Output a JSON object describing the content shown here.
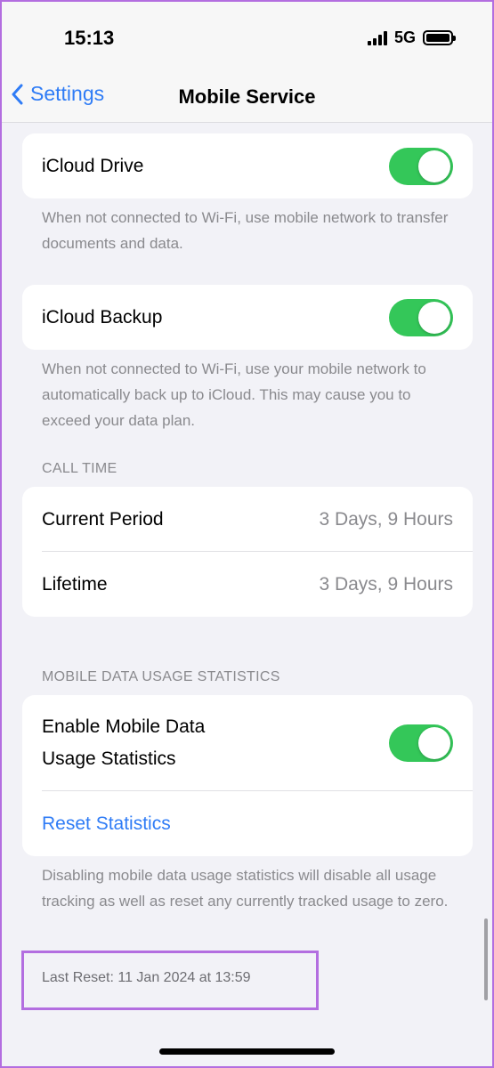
{
  "status_bar": {
    "time": "15:13",
    "network": "5G"
  },
  "nav": {
    "back_label": "Settings",
    "title": "Mobile Service"
  },
  "icloud_drive": {
    "label": "iCloud Drive",
    "enabled": true,
    "footer": "When not connected to Wi-Fi, use mobile network to transfer documents and data."
  },
  "icloud_backup": {
    "label": "iCloud Backup",
    "enabled": true,
    "footer": "When not connected to Wi-Fi, use your mobile network to automatically back up to iCloud. This may cause you to exceed your data plan."
  },
  "call_time": {
    "header": "CALL TIME",
    "rows": [
      {
        "label": "Current Period",
        "value": "3 Days, 9 Hours"
      },
      {
        "label": "Lifetime",
        "value": "3 Days, 9 Hours"
      }
    ]
  },
  "usage_stats": {
    "header": "MOBILE DATA USAGE STATISTICS",
    "enable_label_line1": "Enable Mobile Data",
    "enable_label_line2": "Usage Statistics",
    "enabled": true,
    "reset_label": "Reset Statistics",
    "footer": "Disabling mobile data usage statistics will disable all usage tracking as well as reset any currently tracked usage to zero.",
    "last_reset": "Last Reset: 11 Jan 2024 at 13:59"
  },
  "colors": {
    "accent": "#2f7cf6",
    "toggle_on": "#34c759",
    "highlight": "#b36ee0"
  }
}
